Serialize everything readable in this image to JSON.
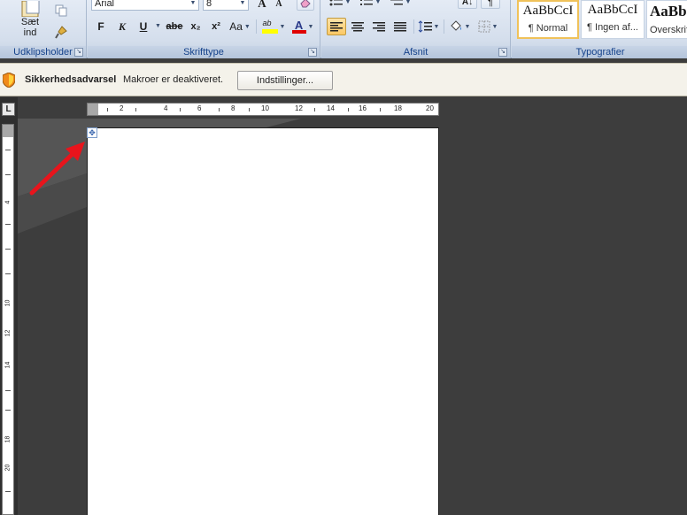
{
  "ribbon": {
    "clipboard": {
      "label": "Udklipsholder",
      "paste_label": "Sæt ind",
      "paste_line1": "Sæt",
      "paste_line2": "ind"
    },
    "font": {
      "label": "Skrifttype",
      "font_name": "Arial",
      "font_size": "8",
      "bold": "F",
      "italic": "K",
      "underline": "U",
      "strikethrough": "abe",
      "subscript": "x₂",
      "superscript": "x²",
      "change_case": "Aa",
      "grow_font": "A",
      "shrink_font": "A",
      "highlight": "ab",
      "font_color": "A"
    },
    "paragraph": {
      "label": "Afsnit"
    },
    "styles": {
      "label": "Typografier",
      "items": [
        {
          "sample": "AaBbCcI",
          "name": "¶ Normal"
        },
        {
          "sample": "AaBbCcI",
          "name": "¶ Ingen af..."
        },
        {
          "sample": "AaBb",
          "name": "Overskrift"
        }
      ]
    }
  },
  "security_bar": {
    "title": "Sikkerhedsadvarsel",
    "message": "Makroer er deaktiveret.",
    "button": "Indstillinger..."
  },
  "ruler": {
    "tab_selector": "L",
    "horizontal_labels": [
      "2",
      "4",
      "6",
      "8",
      "10",
      "12",
      "14",
      "16",
      "18",
      "20"
    ],
    "vertical_labels": [
      "4",
      "10",
      "12",
      "14",
      "18",
      "20"
    ]
  },
  "colors": {
    "highlight": "#ffff00",
    "font_color": "#e00000",
    "arrow": "#e8141c",
    "workspace": "#3d3d3d"
  }
}
